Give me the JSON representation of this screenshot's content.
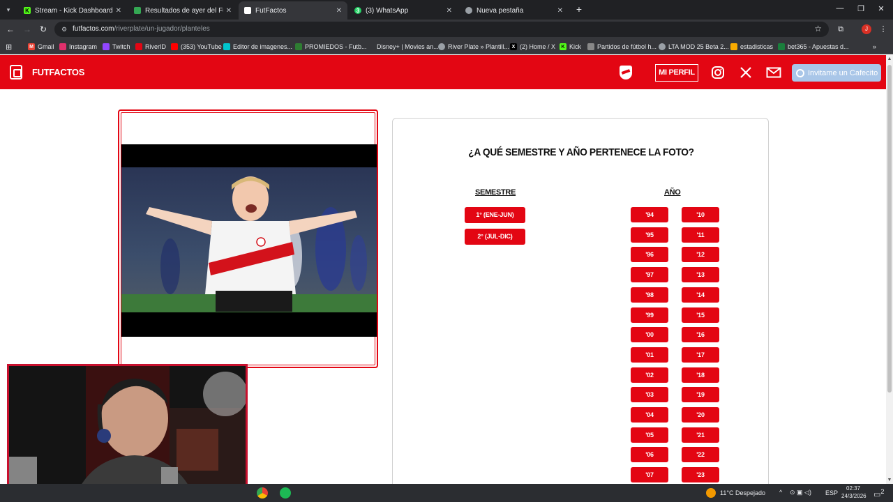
{
  "browser": {
    "tabs": [
      {
        "label": "Stream - Kick Dashboard",
        "favicon": "kick-icon",
        "color": "#53fc18",
        "glyph": "K"
      },
      {
        "label": "Resultados de ayer del Futbol A",
        "favicon": "sheets-icon",
        "color": "#34a853",
        "glyph": ""
      },
      {
        "label": "FutFactos",
        "favicon": "futfactos-icon",
        "color": "#ffffff",
        "glyph": ""
      },
      {
        "label": "(3) WhatsApp",
        "favicon": "whatsapp-icon",
        "color": "#25d366",
        "glyph": "3"
      },
      {
        "label": "Nueva pestaña",
        "favicon": "chrome-icon",
        "color": "#9aa0a6",
        "glyph": ""
      }
    ],
    "url_domain": "futfactos.com",
    "url_path": "/riverplate/un-jugador/planteles",
    "bookmarks": [
      {
        "label": "Gmail",
        "color": "#ea4335",
        "glyph": "M"
      },
      {
        "label": "Instagram",
        "color": "#e1306c",
        "glyph": ""
      },
      {
        "label": "Twitch",
        "color": "#9146ff",
        "glyph": ""
      },
      {
        "label": "RiverID",
        "color": "#e30613",
        "glyph": ""
      },
      {
        "label": "(353) YouTube",
        "color": "#ff0000",
        "glyph": ""
      },
      {
        "label": "Editor de imagenes...",
        "color": "#00c4cc",
        "glyph": ""
      },
      {
        "label": "PROMIEDOS - Futb...",
        "color": "#2e7d32",
        "glyph": ""
      },
      {
        "label": "Disney+ | Movies an...",
        "color": "",
        "glyph": ""
      },
      {
        "label": "River Plate » Plantill...",
        "color": "#9aa0a6",
        "glyph": ""
      },
      {
        "label": "(2) Home / X",
        "color": "#000000",
        "glyph": "X"
      },
      {
        "label": "Kick",
        "color": "#53fc18",
        "glyph": "K"
      },
      {
        "label": "Partidos de fútbol h...",
        "color": "#888888",
        "glyph": ""
      },
      {
        "label": "LTA MOD 25 Beta 2...",
        "color": "#9aa0a6",
        "glyph": ""
      },
      {
        "label": "estadisticas",
        "color": "#f9ab00",
        "glyph": ""
      },
      {
        "label": "bet365 - Apuestas d...",
        "color": "#1a7f3c",
        "glyph": ""
      }
    ],
    "profile_initial": "J"
  },
  "site": {
    "brand": "FUTFACTOS",
    "perfil_label": "MI PERFIL",
    "cafecito_label": "Invitame un Cafecito"
  },
  "quiz": {
    "question": "¿A QUÉ SEMESTRE Y AÑO PERTENECE LA FOTO?",
    "semester_header": "SEMESTRE",
    "year_header": "AÑO",
    "semesters": [
      "1° (ENE-JUN)",
      "2° (JUL-DIC)"
    ],
    "years_col1": [
      "'94",
      "'95",
      "'96",
      "'97",
      "'98",
      "'99",
      "'00",
      "'01",
      "'02",
      "'03",
      "'04",
      "'05",
      "'06",
      "'07"
    ],
    "years_col2": [
      "'10",
      "'11",
      "'12",
      "'13",
      "'14",
      "'15",
      "'16",
      "'17",
      "'18",
      "'19",
      "'20",
      "'21",
      "'22",
      "'23"
    ]
  },
  "taskbar": {
    "weather": "11°C Despejado",
    "lang": "ESP",
    "time": "02:37",
    "date": "24/3/2026",
    "notif_count": "2"
  },
  "colors": {
    "brand_red": "#e30613",
    "chrome_dark": "#202124",
    "chrome_mid": "#35363a"
  }
}
